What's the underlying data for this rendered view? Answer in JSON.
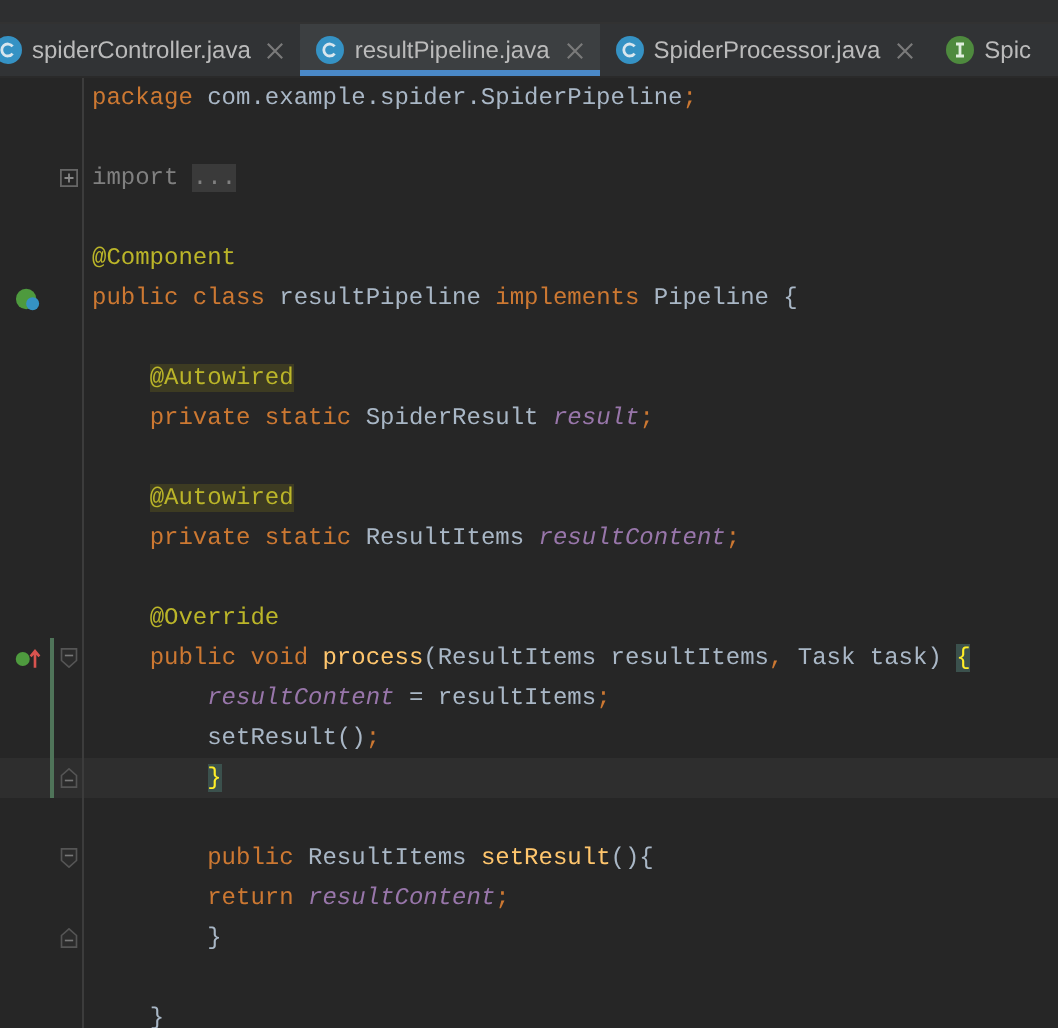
{
  "tabs": [
    {
      "label": "spiderController.java",
      "kind": "class",
      "selected": false,
      "closable": true
    },
    {
      "label": "resultPipeline.java",
      "kind": "class",
      "selected": true,
      "closable": true
    },
    {
      "label": "SpiderProcessor.java",
      "kind": "class",
      "selected": false,
      "closable": true
    },
    {
      "label": "Spic",
      "kind": "interface",
      "selected": false,
      "closable": false
    }
  ],
  "editor": {
    "lines": [
      {
        "kind": "code",
        "tokens": [
          {
            "kind": "kw",
            "text": "package "
          },
          {
            "kind": "plain",
            "text": "com.example.spider.SpiderPipeline"
          },
          {
            "kind": "punct",
            "text": ";"
          }
        ]
      },
      {
        "kind": "blank"
      },
      {
        "kind": "code",
        "collapsed": true,
        "tokens": [
          {
            "kind": "folded",
            "text": "import "
          },
          {
            "kind": "placeholder",
            "text": "..."
          }
        ]
      },
      {
        "kind": "blank"
      },
      {
        "kind": "code",
        "tokens": [
          {
            "kind": "ann",
            "text": "@Component"
          }
        ]
      },
      {
        "kind": "code",
        "implements_marker": true,
        "tokens": [
          {
            "kind": "kw",
            "text": "public class "
          },
          {
            "kind": "plain",
            "text": "resultPipeline "
          },
          {
            "kind": "kw",
            "text": "implements "
          },
          {
            "kind": "plain",
            "text": "Pipeline {"
          }
        ]
      },
      {
        "kind": "blank"
      },
      {
        "kind": "code",
        "tokens": [
          {
            "kind": "ann-warn",
            "text": "    @Autowired"
          }
        ]
      },
      {
        "kind": "code",
        "tokens": [
          {
            "kind": "kw",
            "text": "    private static "
          },
          {
            "kind": "plain",
            "text": "SpiderResult "
          },
          {
            "kind": "field",
            "text": "result"
          },
          {
            "kind": "punct",
            "text": ";"
          }
        ]
      },
      {
        "kind": "blank"
      },
      {
        "kind": "code",
        "tokens": [
          {
            "kind": "ann-warn",
            "text": "    @Autowired"
          }
        ]
      },
      {
        "kind": "code",
        "tokens": [
          {
            "kind": "kw",
            "text": "    private static "
          },
          {
            "kind": "plain",
            "text": "ResultItems "
          },
          {
            "kind": "field",
            "text": "resultContent"
          },
          {
            "kind": "punct",
            "text": ";"
          }
        ]
      },
      {
        "kind": "blank"
      },
      {
        "kind": "code",
        "tokens": [
          {
            "kind": "ann",
            "text": "    @Override"
          }
        ]
      },
      {
        "kind": "code",
        "override_marker": true,
        "fold_start": true,
        "changed": true,
        "tokens": [
          {
            "kind": "kw",
            "text": "    public void "
          },
          {
            "kind": "method",
            "text": "process"
          },
          {
            "kind": "plain",
            "text": "(ResultItems resultItems"
          },
          {
            "kind": "punct",
            "text": ", "
          },
          {
            "kind": "plain",
            "text": "Task task) "
          },
          {
            "kind": "brace",
            "text": "{"
          }
        ]
      },
      {
        "kind": "code",
        "changed": true,
        "tokens": [
          {
            "kind": "field",
            "text": "        resultContent"
          },
          {
            "kind": "plain",
            "text": " = resultItems"
          },
          {
            "kind": "punct",
            "text": ";"
          }
        ]
      },
      {
        "kind": "code",
        "changed": true,
        "tokens": [
          {
            "kind": "plain",
            "text": "        setResult()"
          },
          {
            "kind": "punct",
            "text": ";"
          }
        ]
      },
      {
        "kind": "code",
        "changed": true,
        "current": true,
        "fold_end": true,
        "tokens": [
          {
            "kind": "brace",
            "text": "        }"
          }
        ]
      },
      {
        "kind": "blank"
      },
      {
        "kind": "code",
        "fold_start": true,
        "tokens": [
          {
            "kind": "kw",
            "text": "        public "
          },
          {
            "kind": "plain",
            "text": "ResultItems "
          },
          {
            "kind": "method",
            "text": "setResult"
          },
          {
            "kind": "plain",
            "text": "(){"
          }
        ]
      },
      {
        "kind": "code",
        "tokens": [
          {
            "kind": "kw",
            "text": "        return "
          },
          {
            "kind": "field",
            "text": "resultContent"
          },
          {
            "kind": "punct",
            "text": ";"
          }
        ]
      },
      {
        "kind": "code",
        "fold_end": true,
        "tokens": [
          {
            "kind": "plain",
            "text": "        }"
          }
        ]
      },
      {
        "kind": "blank"
      },
      {
        "kind": "code",
        "tokens": [
          {
            "kind": "plain",
            "text": "    }"
          }
        ]
      }
    ]
  }
}
